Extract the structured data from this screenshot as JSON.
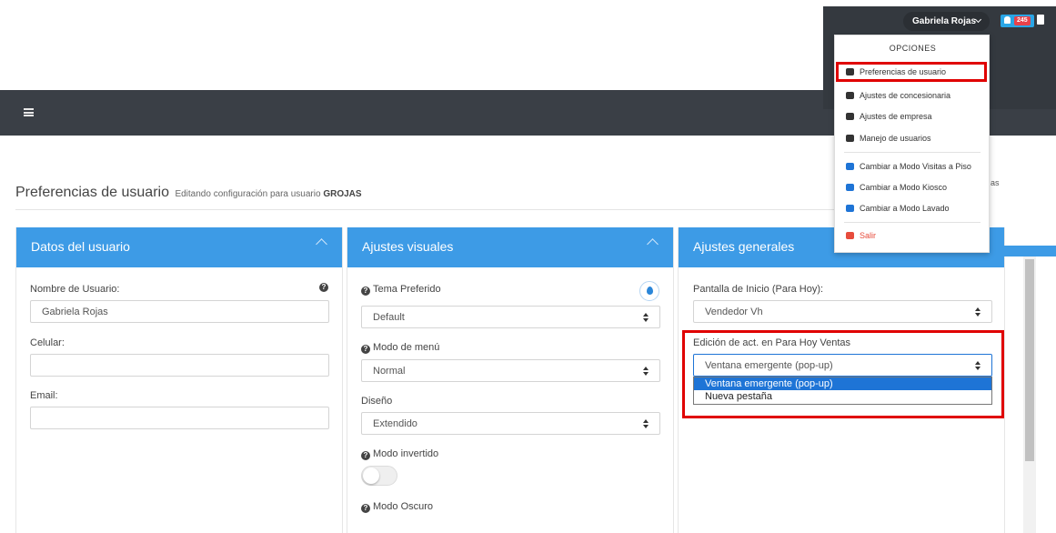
{
  "account": {
    "user_name": "Gabriela Rojas",
    "notification_count": "245"
  },
  "menu": {
    "title": "OPCIONES",
    "items": [
      {
        "label": "Preferencias de usuario"
      },
      {
        "label": "Ajustes de concesionaria"
      },
      {
        "label": "Ajustes de empresa"
      },
      {
        "label": "Manejo de usuarios"
      },
      {
        "label": "Cambiar a Modo Visitas a Piso"
      },
      {
        "label": "Cambiar a Modo Kiosco"
      },
      {
        "label": "Cambiar a Modo Lavado"
      },
      {
        "label": "Salir"
      }
    ]
  },
  "page": {
    "title": "Preferencias de usuario",
    "subtitle_prefix": "Editando configuración para usuario",
    "subtitle_user": "GROJAS",
    "clipped_text": "as"
  },
  "panels": {
    "datos": {
      "title": "Datos del usuario",
      "username_label": "Nombre de Usuario:",
      "username_value": "Gabriela Rojas",
      "celular_label": "Celular:",
      "celular_value": "",
      "email_label": "Email:",
      "email_value": ""
    },
    "visuales": {
      "title": "Ajustes visuales",
      "tema_label": "Tema Preferido",
      "tema_value": "Default",
      "modo_menu_label": "Modo de menú",
      "modo_menu_value": "Normal",
      "diseno_label": "Diseño",
      "diseno_value": "Extendido",
      "invertido_label": "Modo invertido",
      "invertido_on": false,
      "oscuro_label": "Modo Oscuro"
    },
    "generales": {
      "title": "Ajustes generales",
      "inicio_label": "Pantalla de Inicio (Para Hoy):",
      "inicio_value": "Vendedor Vh",
      "edicion_label": "Edición de act. en Para Hoy Ventas",
      "edicion_value": "Ventana emergente (pop-up)",
      "edicion_options": [
        "Ventana emergente (pop-up)",
        "Nueva pestaña"
      ]
    }
  },
  "colors": {
    "panel_header": "#3d9be6",
    "topbar": "#3a3f46",
    "highlight": "#e00000",
    "selected_option": "#1e74d6"
  }
}
